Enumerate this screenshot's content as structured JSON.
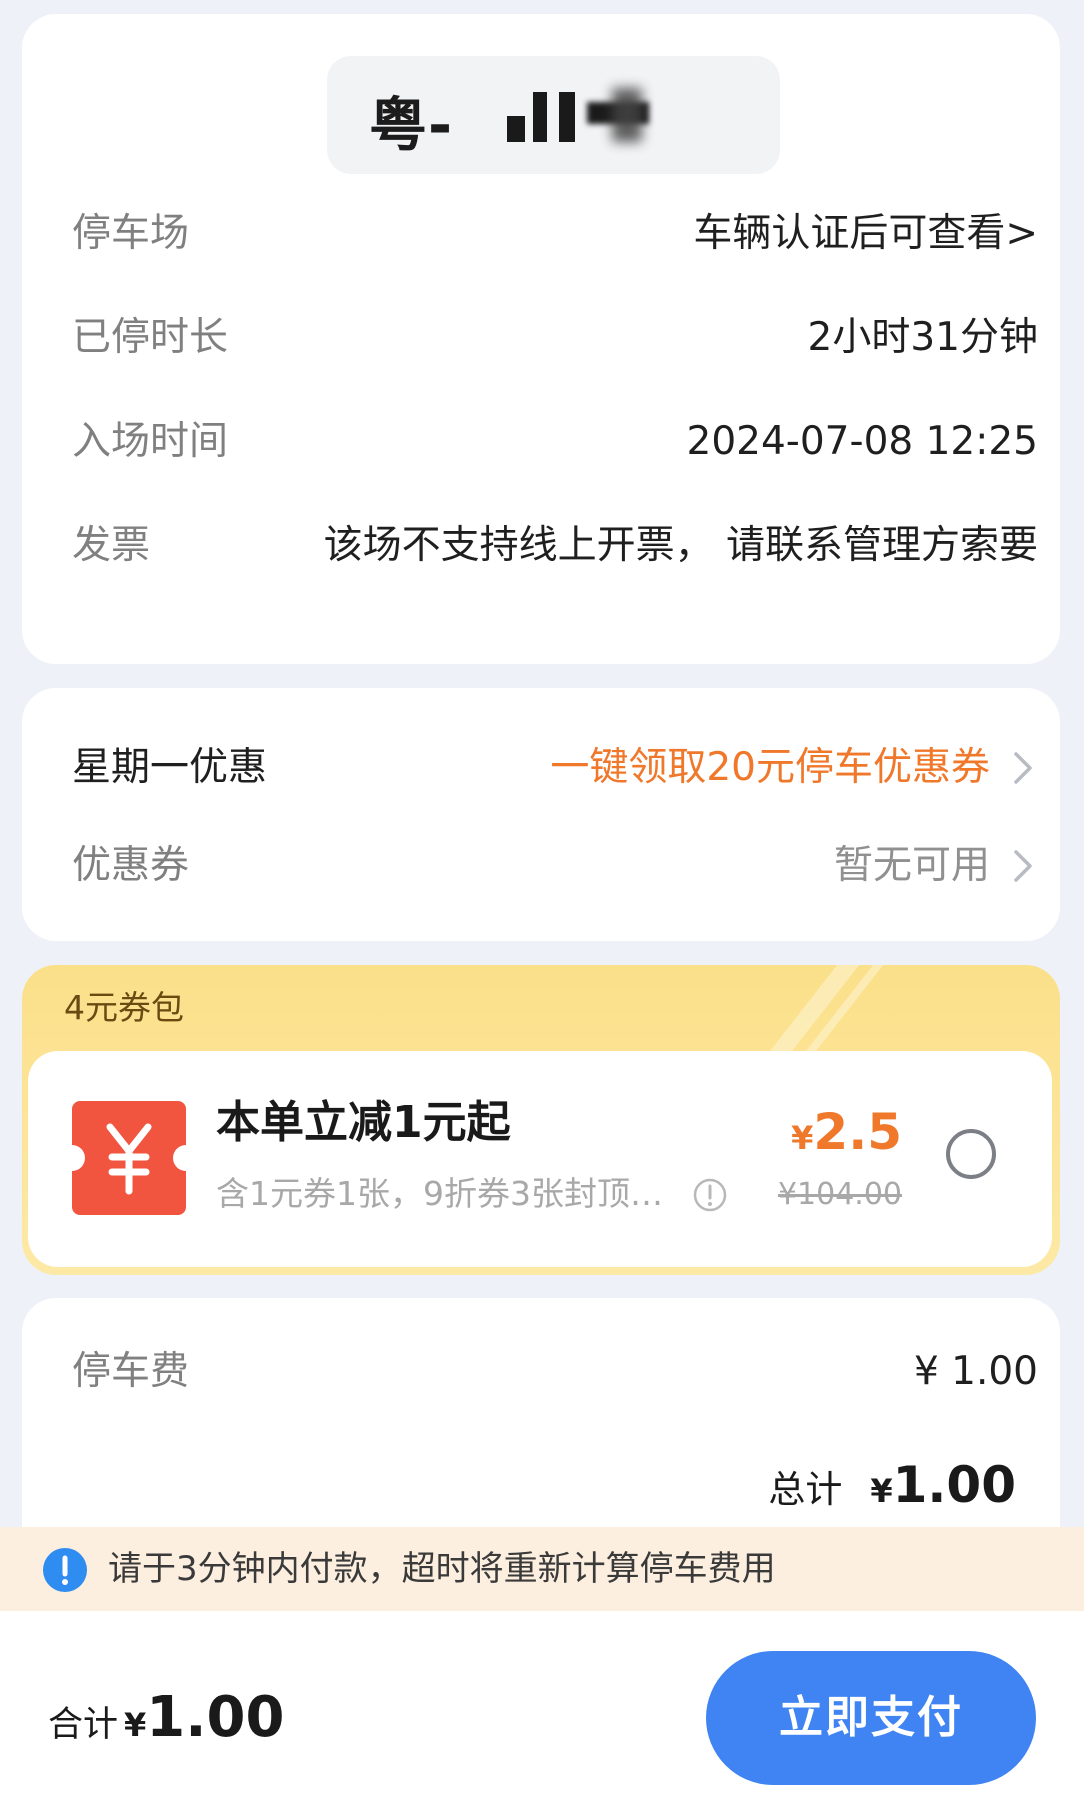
{
  "vehicle": {
    "plate_prefix": "粤-"
  },
  "info": {
    "rows": [
      {
        "label": "停车场",
        "value": "车辆认证后可查看>"
      },
      {
        "label": "已停时长",
        "value": "2小时31分钟"
      },
      {
        "label": "入场时间",
        "value": "2024-07-08 12:25"
      },
      {
        "label": "发票",
        "value": "该场不支持线上开票， 请联系管理方索要"
      }
    ]
  },
  "discounts": {
    "weekday": {
      "label": "星期一优惠",
      "value": "一键领取20元停车优惠券"
    },
    "coupon": {
      "label": "优惠券",
      "value": "暂无可用"
    }
  },
  "coupon_pack": {
    "title": "4元券包",
    "headline": "本单立减1元起",
    "subtitle": "含1元券1张，9折券3张封顶…",
    "currency": "¥",
    "price": "2.5",
    "original_price": "¥104.00",
    "selected": false
  },
  "fee": {
    "label": "停车费",
    "value": "¥ 1.00",
    "total_label": "总计",
    "total_currency": "¥",
    "total_amount": "1.00"
  },
  "notice": {
    "text": "请于3分钟内付款，超时将重新计算停车费用",
    "icon": "exclamation-icon"
  },
  "bottom": {
    "label": "合计",
    "currency": "¥",
    "amount": "1.00",
    "pay_label": "立即支付"
  },
  "colors": {
    "accent_orange": "#f0782b",
    "pay_blue": "#3f84f2",
    "coupon_red": "#f2553f",
    "pack_yellow": "#fbe08a",
    "notice_bg": "#fcefdf",
    "label_gray": "#808080"
  }
}
